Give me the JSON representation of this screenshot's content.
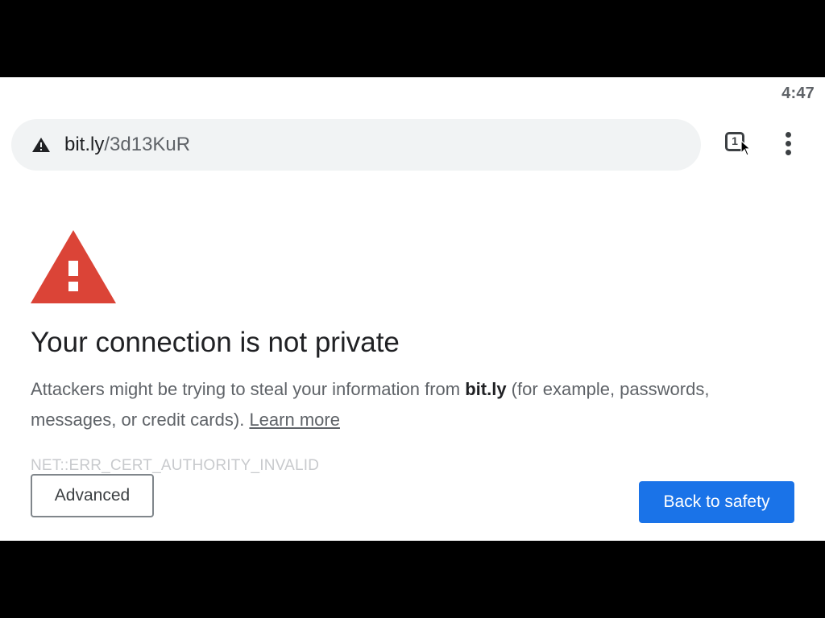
{
  "status_bar": {
    "time": "4:47"
  },
  "toolbar": {
    "url_host": "bit.ly",
    "url_path": "/3d13KuR",
    "security_icon": "warning-triangle-icon",
    "tab_count": "1",
    "tab_switcher_icon": "tab-switcher-icon",
    "menu_icon": "more-vert-icon"
  },
  "interstitial": {
    "icon": "red-warning-triangle-icon",
    "icon_color": "#db4437",
    "title": "Your connection is not private",
    "message_before": "Attackers might be trying to steal your information from ",
    "message_host": "bit.ly",
    "message_after": " (for example, passwords, messages, or credit cards). ",
    "learn_more": "Learn more",
    "error_code": "NET::ERR_CERT_AUTHORITY_INVALID",
    "advanced_label": "Advanced",
    "back_label": "Back to safety",
    "primary_color": "#1a73e8"
  }
}
